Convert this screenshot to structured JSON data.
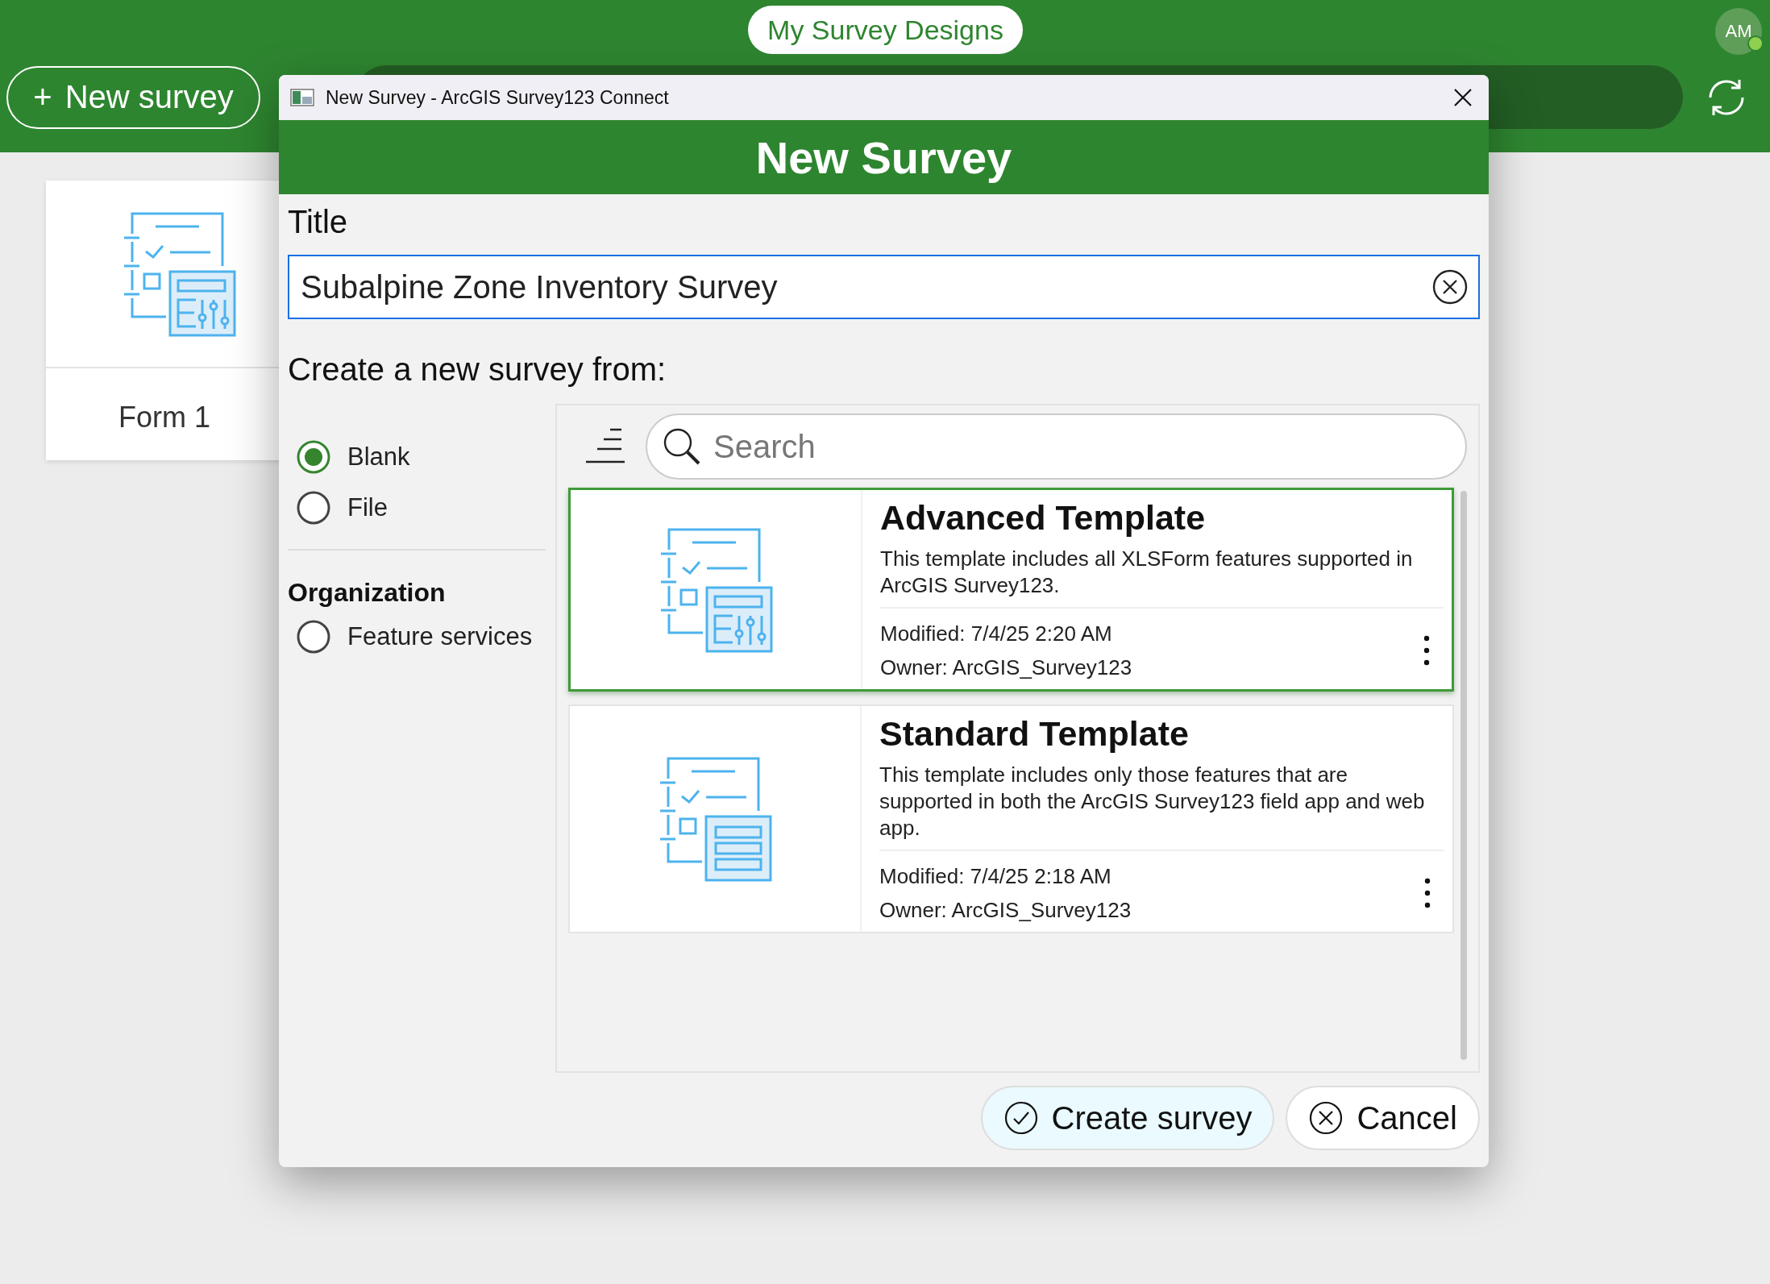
{
  "header": {
    "title": "My Survey Designs",
    "new_button_icon": "+",
    "new_button": "New survey",
    "avatar": "AM"
  },
  "form_cards": [
    {
      "title": "Form 1",
      "kind": "advanced"
    }
  ],
  "dialog": {
    "window_title": "New Survey - ArcGIS Survey123 Connect",
    "heading": "New Survey",
    "title_label": "Title",
    "title_value": "Subalpine Zone Inventory Survey",
    "source_label": "Create a new survey from:",
    "sources": [
      {
        "label": "Blank",
        "selected": true
      },
      {
        "label": "File",
        "selected": false
      }
    ],
    "organization_label": "Organization",
    "organization_sources": [
      {
        "label": "Feature services",
        "selected": false
      }
    ],
    "search": {
      "placeholder": "Search"
    },
    "templates": [
      {
        "title": "Advanced Template",
        "description": "This template includes all XLSForm features supported in ArcGIS Survey123.",
        "modified": "Modified: 7/4/25 2:20 AM",
        "owner": "Owner: ArcGIS_Survey123",
        "selected": true,
        "kind": "advanced"
      },
      {
        "title": "Standard Template",
        "description": "This template includes only those features that are supported in both the ArcGIS Survey123 field app and web app.",
        "modified": "Modified: 7/4/25 2:18 AM",
        "owner": "Owner: ArcGIS_Survey123",
        "selected": false,
        "kind": "standard"
      }
    ],
    "buttons": {
      "create": "Create survey",
      "cancel": "Cancel"
    }
  }
}
